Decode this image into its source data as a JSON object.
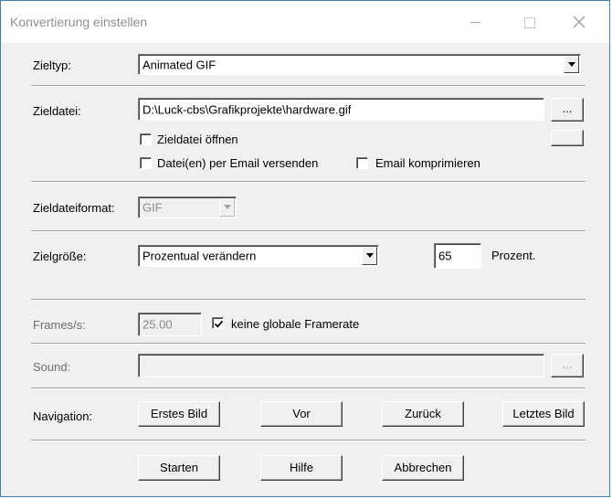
{
  "window": {
    "title": "Konvertierung einstellen"
  },
  "zieltyp": {
    "label": "Zieltyp:",
    "value": "Animated GIF"
  },
  "zieldatei": {
    "label": "Zieldatei:",
    "value": "D:\\Luck-cbs\\Grafikprojekte\\hardware.gif",
    "browse_label": "...",
    "open_checkbox": {
      "label": "Zieldatei öffnen",
      "checked": false
    },
    "email_checkbox": {
      "label": "Datei(en) per Email versenden",
      "checked": false
    },
    "compress_checkbox": {
      "label": "Email komprimieren",
      "checked": false
    }
  },
  "zieldateiformat": {
    "label": "Zieldateiformat:",
    "value": "GIF"
  },
  "zielgroesse": {
    "label": "Zielgröße:",
    "value": "Prozentual verändern",
    "percent_value": "65",
    "percent_label": "Prozent."
  },
  "frames": {
    "label": "Frames/s:",
    "value": "25.00",
    "global_checkbox": {
      "label": "keine globale Framerate",
      "checked": true
    }
  },
  "sound": {
    "label": "Sound:",
    "value": "",
    "browse_label": "..."
  },
  "navigation": {
    "label": "Navigation:",
    "first": "Erstes Bild",
    "next": "Vor",
    "back": "Zurück",
    "last": "Letztes Bild"
  },
  "actions": {
    "start": "Starten",
    "help": "Hilfe",
    "cancel": "Abbrechen"
  }
}
